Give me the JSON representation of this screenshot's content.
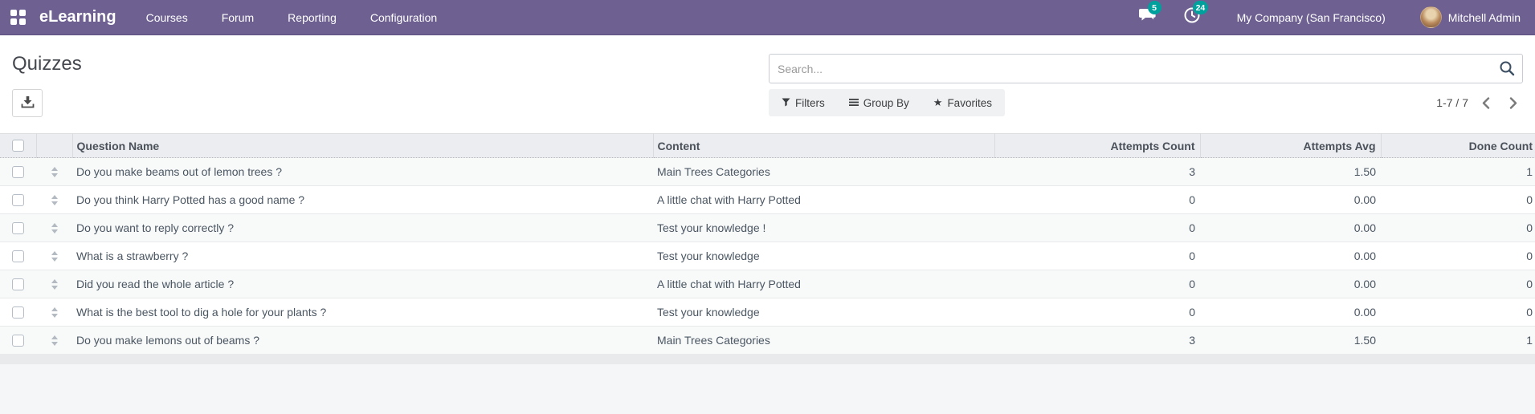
{
  "navbar": {
    "app_name": "eLearning",
    "menu_items": [
      "Courses",
      "Forum",
      "Reporting",
      "Configuration"
    ],
    "messages_badge": "5",
    "activities_badge": "24",
    "company": "My Company (San Francisco)",
    "user": "Mitchell Admin",
    "colors": {
      "background": "#6e6192",
      "badge": "#00a09d"
    }
  },
  "control_panel": {
    "title": "Quizzes",
    "search_placeholder": "Search...",
    "filters_label": "Filters",
    "group_by_label": "Group By",
    "favorites_label": "Favorites",
    "pager_text": "1-7 / 7"
  },
  "table": {
    "columns": [
      "Question Name",
      "Content",
      "Attempts Count",
      "Attempts Avg",
      "Done Count"
    ],
    "header_background": "#ebedf0",
    "rows": [
      {
        "question": "Do you make beams out of lemon trees ?",
        "content": "Main Trees Categories",
        "attempts_count": "3",
        "attempts_avg": "1.50",
        "done_count": "1"
      },
      {
        "question": "Do you think Harry Potted has a good name ?",
        "content": "A little chat with Harry Potted",
        "attempts_count": "0",
        "attempts_avg": "0.00",
        "done_count": "0"
      },
      {
        "question": "Do you want to reply correctly ?",
        "content": "Test your knowledge !",
        "attempts_count": "0",
        "attempts_avg": "0.00",
        "done_count": "0"
      },
      {
        "question": "What is a strawberry ?",
        "content": "Test your knowledge",
        "attempts_count": "0",
        "attempts_avg": "0.00",
        "done_count": "0"
      },
      {
        "question": "Did you read the whole article ?",
        "content": "A little chat with Harry Potted",
        "attempts_count": "0",
        "attempts_avg": "0.00",
        "done_count": "0"
      },
      {
        "question": "What is the best tool to dig a hole for your plants ?",
        "content": "Test your knowledge",
        "attempts_count": "0",
        "attempts_avg": "0.00",
        "done_count": "0"
      },
      {
        "question": "Do you make lemons out of beams ?",
        "content": "Main Trees Categories",
        "attempts_count": "3",
        "attempts_avg": "1.50",
        "done_count": "1"
      }
    ]
  }
}
